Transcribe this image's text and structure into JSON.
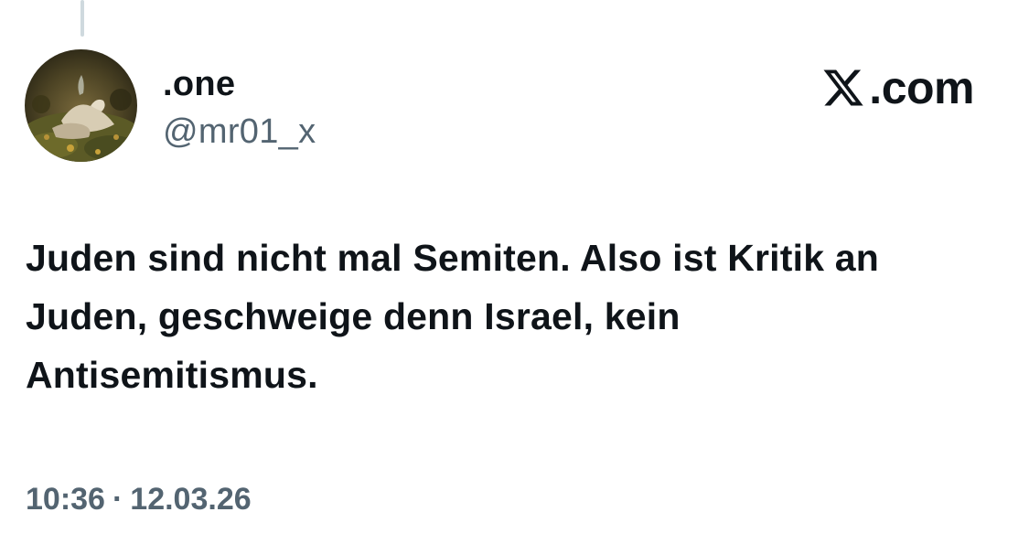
{
  "tweet": {
    "author": {
      "display_name": ".one",
      "handle": "@mr01_x",
      "avatar_icon": "avatar-photo"
    },
    "brand": {
      "logo_icon": "x-logo-icon",
      "text": ".com"
    },
    "text": "Juden sind nicht mal Semiten. Also ist Kritik an Juden, geschweige denn Israel, kein Antisemitismus.",
    "time": "10:36",
    "separator": "·",
    "date": "12.03.26"
  },
  "colors": {
    "text_primary": "#0f1419",
    "text_secondary": "#536471",
    "thread_line": "#cfd9de",
    "background": "#ffffff"
  }
}
